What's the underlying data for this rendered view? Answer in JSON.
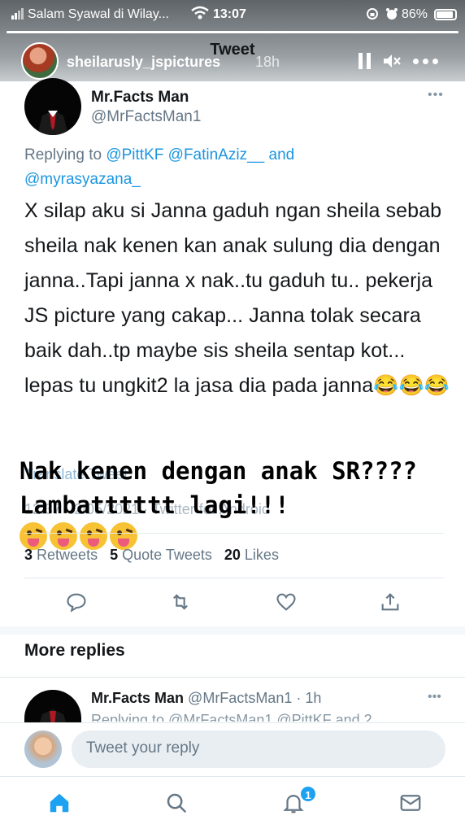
{
  "status_bar": {
    "carrier": "Salam Syawal di Wilay...",
    "time": "13:07",
    "battery": "86%"
  },
  "story": {
    "username": "sheilarusly_jspictures",
    "age": "18h",
    "progress": 1.0
  },
  "header": {
    "title": "Tweet"
  },
  "tweet": {
    "author_name": "Mr.Facts Man",
    "author_handle": "@MrFactsMan1",
    "replying_prefix": "Replying to ",
    "mention_1": "@PittKF",
    "mention_2": "@FatinAziz__",
    "mention_joiner": " and",
    "mention_3": "@myrasyazana_",
    "body": "X silap aku si Janna gaduh ngan sheila sebab sheila nak kenen kan anak sulung dia dengan janna..Tapi janna x nak..tu gaduh tu.. pekerja JS picture yang cakap...  Janna tolak secara baik dah..tp maybe sis sheila sentap kot... lepas tu ungkit2 la jasa dia pada janna😂😂😂",
    "translate_hint": "Translate Tweet",
    "timestamp_hint": "12:37 · 2/05/2021 · Twitter for Android"
  },
  "overlay": {
    "caption": "Nak kenen dengan anak SR???? Lambatttttt lagi!!!",
    "emojis": [
      "zany-face",
      "zany-face",
      "zany-face",
      "zany-face"
    ]
  },
  "stats": {
    "retweets_count": "3",
    "retweets_label": "Retweets",
    "quotes_count": "5",
    "quotes_label": "Quote Tweets",
    "likes_count": "20",
    "likes_label": "Likes"
  },
  "actions": [
    "reply-icon",
    "retweet-icon",
    "like-icon",
    "share-icon"
  ],
  "more_replies": {
    "title": "More replies"
  },
  "reply": {
    "author_name": "Mr.Facts Man",
    "meta": "@MrFactsMan1 · 1h",
    "sub": "Replying to @MrFactsMan1 @PittKF and 2"
  },
  "composer": {
    "placeholder": "Tweet your reply"
  },
  "tabbar": {
    "tabs": [
      "home-icon",
      "search-icon",
      "notifications-icon",
      "messages-icon"
    ],
    "notification_badge": "1"
  },
  "colors": {
    "accent": "#1da1f2",
    "mention": "#1b95e0",
    "secondary_text": "#657786"
  }
}
